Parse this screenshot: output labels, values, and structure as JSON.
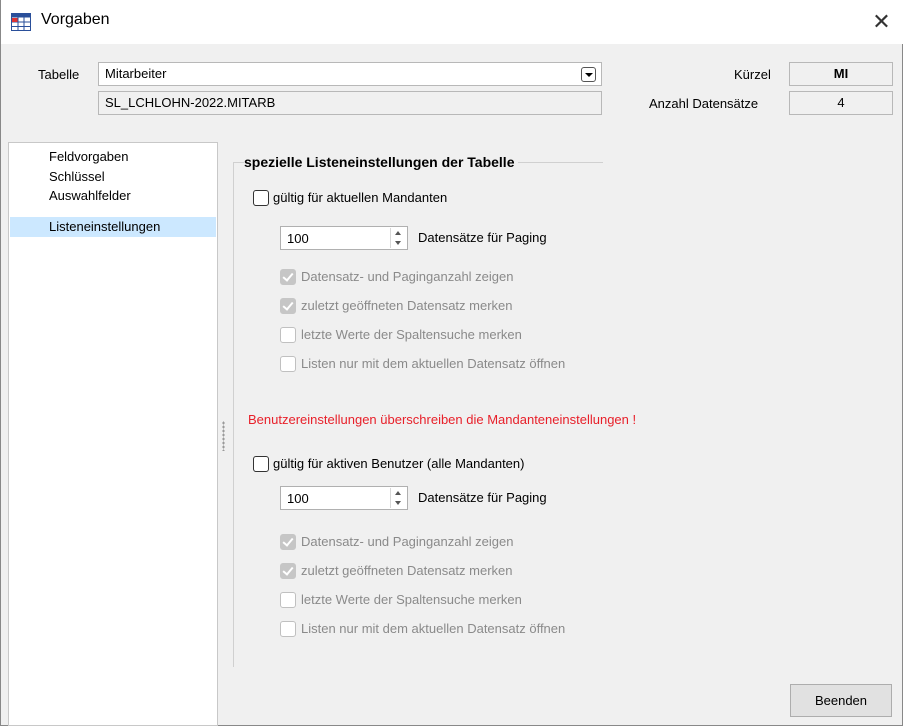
{
  "window": {
    "title": "Vorgaben",
    "close_glyph": "✕",
    "app_icon": "table-grid-icon"
  },
  "header": {
    "tabelle_label": "Tabelle",
    "tabelle_value": "Mitarbeiter",
    "table_path": "SL_LCHLOHN-2022.MITARB",
    "kuerzel_label": "Kürzel",
    "kuerzel_value": "MI",
    "anzahl_label": "Anzahl Datensätze",
    "anzahl_value": "4"
  },
  "sidebar": {
    "items": [
      {
        "label": "Feldvorgaben"
      },
      {
        "label": "Schlüssel"
      },
      {
        "label": "Auswahlfelder"
      },
      {
        "label": "Listeneinstellungen",
        "selected": true
      }
    ]
  },
  "main": {
    "group_title": "spezielle Listeneinstellungen der Tabelle",
    "mandant": {
      "checkbox_label": "gültig für aktuellen Mandanten",
      "checked": false,
      "paging_value": "100",
      "paging_label": "Datensätze für Paging",
      "options": [
        {
          "label": "Datensatz- und Paginganzahl zeigen",
          "checked": true
        },
        {
          "label": "zuletzt geöffneten Datensatz merken",
          "checked": true
        },
        {
          "label": "letzte Werte der Spaltensuche merken",
          "checked": false
        },
        {
          "label": "Listen nur mit dem aktuellen Datensatz öffnen",
          "checked": false
        }
      ]
    },
    "warning": "Benutzereinstellungen überschreiben die Mandanteneinstellungen !",
    "benutzer": {
      "checkbox_label": "gültig für aktiven Benutzer (alle Mandanten)",
      "checked": false,
      "paging_value": "100",
      "paging_label": "Datensätze für Paging",
      "options": [
        {
          "label": "Datensatz- und Paginganzahl zeigen",
          "checked": true
        },
        {
          "label": "zuletzt geöffneten Datensatz merken",
          "checked": true
        },
        {
          "label": "letzte Werte der Spaltensuche merken",
          "checked": false
        },
        {
          "label": "Listen nur mit dem aktuellen Datensatz öffnen",
          "checked": false
        }
      ]
    }
  },
  "footer": {
    "beenden_label": "Beenden"
  },
  "colors": {
    "warning": "#e8202a",
    "selection": "#cce8ff",
    "accent": "#0078d7"
  }
}
